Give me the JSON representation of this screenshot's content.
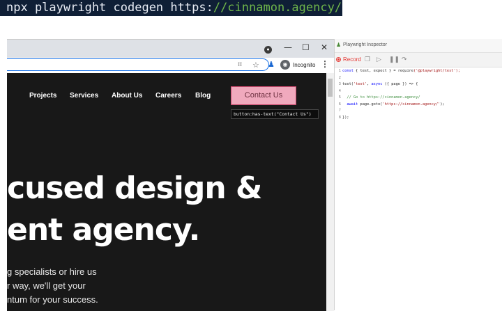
{
  "terminal": {
    "command": "npx playwright codegen ",
    "url_part_a": "https:",
    "url_part_b": "//cinnamon.agency/"
  },
  "browser": {
    "window_controls": {
      "minimize": "—",
      "maximize": "☐",
      "close": "✕"
    },
    "incognito_label": "Incognito",
    "nav": {
      "items": [
        "Projects",
        "Services",
        "About Us",
        "Careers",
        "Blog"
      ],
      "contact_label": "Contact Us"
    },
    "selector_tooltip": "button:has-text(\"Contact Us\")",
    "hero": {
      "line1": "cused design &",
      "line2": "ent agency.",
      "sub1": "g specialists or hire us",
      "sub2": "r way, we'll get your",
      "sub3": "ntum for your success."
    }
  },
  "inspector": {
    "title": "Playwright Inspector",
    "record_label": "Record",
    "code": [
      {
        "n": "1",
        "parts": [
          {
            "t": "const",
            "c": "kw"
          },
          {
            "t": " { test, expect } = ",
            "c": "plain"
          },
          {
            "t": "require",
            "c": "plain"
          },
          {
            "t": "('@playwright/test');",
            "c": "str"
          }
        ]
      },
      {
        "n": "2",
        "parts": []
      },
      {
        "n": "3",
        "parts": [
          {
            "t": "test(",
            "c": "plain"
          },
          {
            "t": "'test'",
            "c": "str"
          },
          {
            "t": ", ",
            "c": "plain"
          },
          {
            "t": "async",
            "c": "kw"
          },
          {
            "t": " ({ page }) => {",
            "c": "plain"
          }
        ]
      },
      {
        "n": "4",
        "parts": []
      },
      {
        "n": "5",
        "parts": [
          {
            "t": "  // Go to https://cinnamon.agency/",
            "c": "com"
          }
        ]
      },
      {
        "n": "6",
        "parts": [
          {
            "t": "  await",
            "c": "kw"
          },
          {
            "t": " page.goto(",
            "c": "plain"
          },
          {
            "t": "'https://cinnamon.agency/'",
            "c": "str"
          },
          {
            "t": ");",
            "c": "plain"
          }
        ]
      },
      {
        "n": "7",
        "parts": []
      },
      {
        "n": "8",
        "parts": [
          {
            "t": "});",
            "c": "plain"
          }
        ]
      }
    ]
  },
  "colors": {
    "terminal_bg": "#0f1f36",
    "url_green": "#6fb64a",
    "contact_bg": "#f0a9bd",
    "record_red": "#e53935",
    "page_bg": "#181818"
  }
}
